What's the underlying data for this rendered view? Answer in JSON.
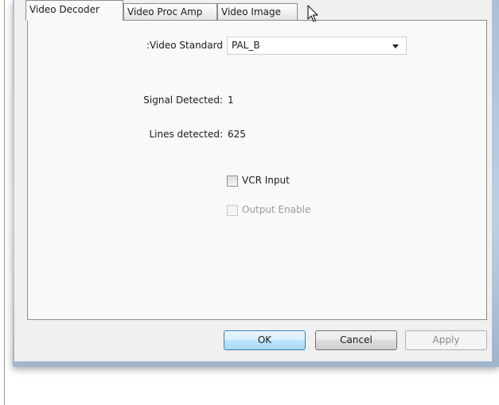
{
  "tabs": [
    {
      "label": "Video Decoder",
      "active": true
    },
    {
      "label": "Video Proc Amp",
      "active": false
    },
    {
      "label": "Video Image",
      "active": false
    }
  ],
  "video_standard": {
    "label": ":Video Standard",
    "value": "PAL_B"
  },
  "signal_detected": {
    "label": "Signal Detected:",
    "value": "1"
  },
  "lines_detected": {
    "label": "Lines detected:",
    "value": "625"
  },
  "vcr_input": {
    "label": "VCR Input",
    "checked": false,
    "enabled": true
  },
  "output_enable": {
    "label": "Output Enable",
    "checked": false,
    "enabled": false
  },
  "buttons": {
    "ok": "OK",
    "cancel": "Cancel",
    "apply": "Apply"
  },
  "colors": {
    "window_frame": "#b2c8de",
    "dialog_bg": "#f0f0f0",
    "default_button": "#a7d9f5"
  }
}
